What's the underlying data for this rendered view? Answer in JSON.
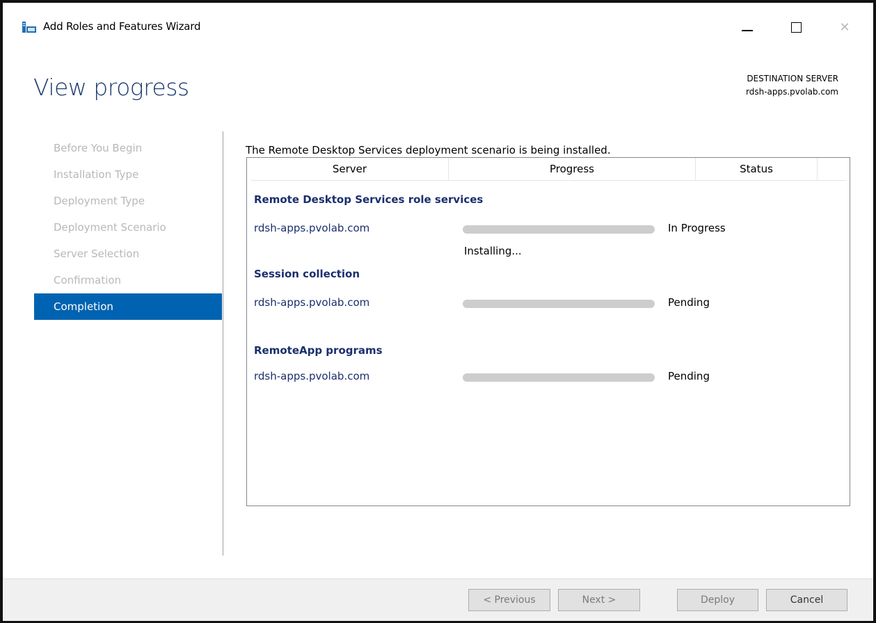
{
  "window": {
    "title": "Add Roles and Features Wizard"
  },
  "header": {
    "page_title": "View progress",
    "destination_label": "DESTINATION SERVER",
    "destination_server": "rdsh-apps.pvolab.com"
  },
  "nav": {
    "items": [
      {
        "label": "Before You Begin"
      },
      {
        "label": "Installation Type"
      },
      {
        "label": "Deployment Type"
      },
      {
        "label": "Deployment Scenario"
      },
      {
        "label": "Server Selection"
      },
      {
        "label": "Confirmation"
      },
      {
        "label": "Completion"
      }
    ],
    "active_index": 6
  },
  "main": {
    "status_message": "The Remote Desktop Services deployment scenario is being installed.",
    "columns": [
      "Server",
      "Progress",
      "Status"
    ],
    "groups": [
      {
        "title": "Remote Desktop Services role services",
        "server": "rdsh-apps.pvolab.com",
        "progress": 0,
        "status": "In Progress",
        "detail": "Installing..."
      },
      {
        "title": "Session collection",
        "server": "rdsh-apps.pvolab.com",
        "progress": 0,
        "status": "Pending",
        "detail": ""
      },
      {
        "title": "RemoteApp programs",
        "server": "rdsh-apps.pvolab.com",
        "progress": 0,
        "status": "Pending",
        "detail": ""
      }
    ]
  },
  "footer": {
    "previous_label": "< Previous",
    "next_label": "Next >",
    "deploy_label": "Deploy",
    "cancel_label": "Cancel"
  },
  "colors": {
    "accent": "#0063b1",
    "title": "#1a3a6e",
    "progress_track": "#cdcdcd"
  }
}
